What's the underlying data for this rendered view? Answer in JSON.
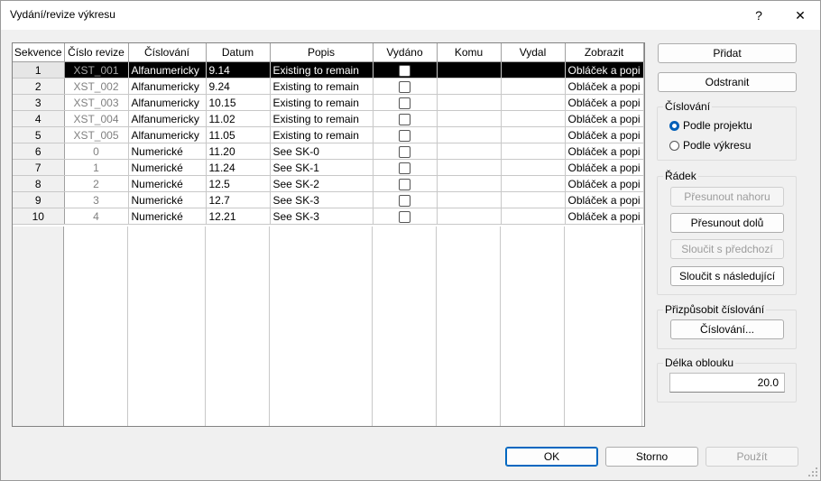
{
  "window": {
    "title": "Vydání/revize výkresu",
    "help_label": "?",
    "close_label": "✕"
  },
  "grid": {
    "columns": [
      "Sekvence",
      "Číslo revize",
      "Číslování",
      "Datum",
      "Popis",
      "Vydáno",
      "Komu",
      "Vydal",
      "Zobrazit"
    ],
    "rows": [
      {
        "seq": "1",
        "rev": "XST_001",
        "num": "Alfanumericky",
        "date": "9.14",
        "desc": "Existing to remain",
        "komu": "",
        "vydal": "",
        "show": "Obláček a popi",
        "selected": true
      },
      {
        "seq": "2",
        "rev": "XST_002",
        "num": "Alfanumericky",
        "date": "9.24",
        "desc": "Existing to remain",
        "komu": "",
        "vydal": "",
        "show": "Obláček a popi"
      },
      {
        "seq": "3",
        "rev": "XST_003",
        "num": "Alfanumericky",
        "date": "10.15",
        "desc": "Existing to remain",
        "komu": "",
        "vydal": "",
        "show": "Obláček a popi"
      },
      {
        "seq": "4",
        "rev": "XST_004",
        "num": "Alfanumericky",
        "date": "11.02",
        "desc": "Existing to remain",
        "komu": "",
        "vydal": "",
        "show": "Obláček a popi"
      },
      {
        "seq": "5",
        "rev": "XST_005",
        "num": "Alfanumericky",
        "date": "11.05",
        "desc": "Existing to remain",
        "komu": "",
        "vydal": "",
        "show": "Obláček a popi"
      },
      {
        "seq": "6",
        "rev": "0",
        "num": "Numerické",
        "date": "11.20",
        "desc": "See SK-0",
        "komu": "",
        "vydal": "",
        "show": "Obláček a popi"
      },
      {
        "seq": "7",
        "rev": "1",
        "num": "Numerické",
        "date": "11.24",
        "desc": "See SK-1",
        "komu": "",
        "vydal": "",
        "show": "Obláček a popi"
      },
      {
        "seq": "8",
        "rev": "2",
        "num": "Numerické",
        "date": "12.5",
        "desc": "See SK-2",
        "komu": "",
        "vydal": "",
        "show": "Obláček a popi"
      },
      {
        "seq": "9",
        "rev": "3",
        "num": "Numerické",
        "date": "12.7",
        "desc": "See SK-3",
        "komu": "",
        "vydal": "",
        "show": "Obláček a popi"
      },
      {
        "seq": "10",
        "rev": "4",
        "num": "Numerické",
        "date": "12.21",
        "desc": "See SK-3",
        "komu": "",
        "vydal": "",
        "show": "Obláček a popi"
      }
    ]
  },
  "side": {
    "add": "Přidat",
    "remove": "Odstranit",
    "numbering_group": "Číslování",
    "by_project": "Podle projektu",
    "by_sheet": "Podle výkresu",
    "selected_option": "by_project",
    "row_group": "Řádek",
    "move_up": "Přesunout nahoru",
    "move_down": "Přesunout dolů",
    "merge_prev": "Sloučit s předchozí",
    "merge_next": "Sloučit s následující",
    "custom_group": "Přizpůsobit číslování",
    "numbering_btn": "Číslování...",
    "arc_group": "Délka oblouku",
    "arc_value": "20.0"
  },
  "footer": {
    "ok": "OK",
    "cancel": "Storno",
    "apply": "Použít"
  },
  "colors": {
    "accent": "#005fb8",
    "selection": "#000000"
  }
}
